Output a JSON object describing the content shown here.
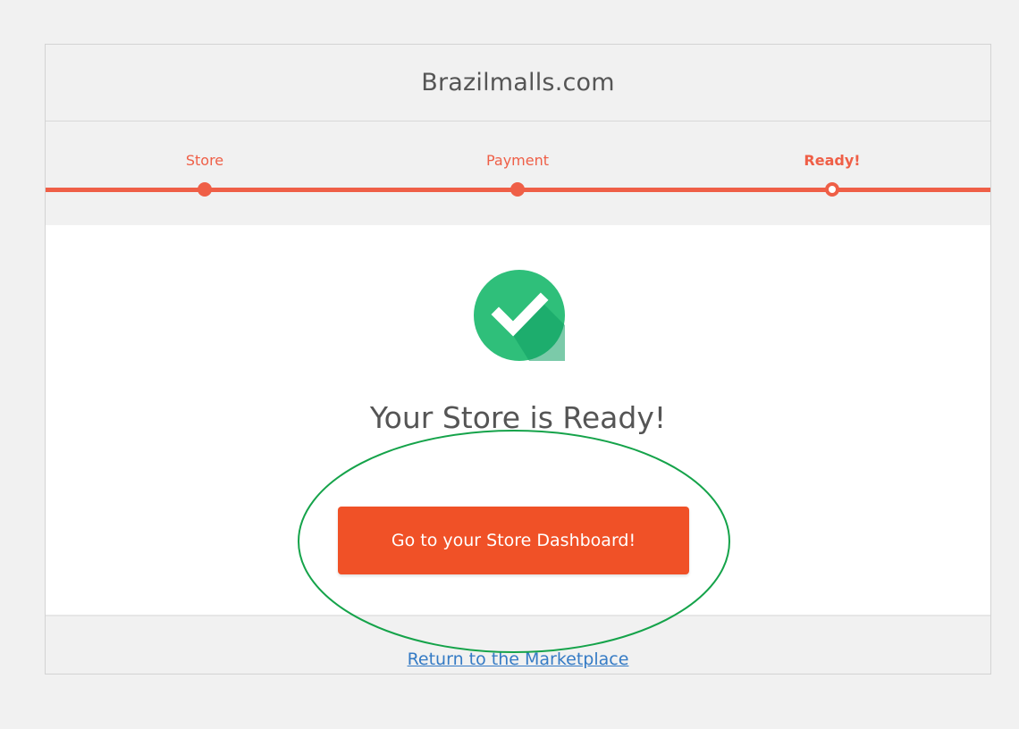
{
  "site": {
    "title": "Brazilmalls.com"
  },
  "steps": [
    {
      "label": "Store",
      "state": "complete"
    },
    {
      "label": "Payment",
      "state": "complete"
    },
    {
      "label": "Ready!",
      "state": "current"
    }
  ],
  "success": {
    "icon": "check-circle-icon",
    "title": "Your Store is Ready!"
  },
  "actions": {
    "dashboard_button": "Go to your Store Dashboard!",
    "marketplace_link": "Return to the Marketplace"
  },
  "colors": {
    "accent": "#ef5f47",
    "button": "#f05127",
    "success": "#2fbf7a",
    "success_shadow": "#0e9f63",
    "annotation": "#15a34a",
    "link": "#357bc5"
  },
  "annotation": {
    "shape": "ellipse",
    "target": "dashboard-button"
  }
}
